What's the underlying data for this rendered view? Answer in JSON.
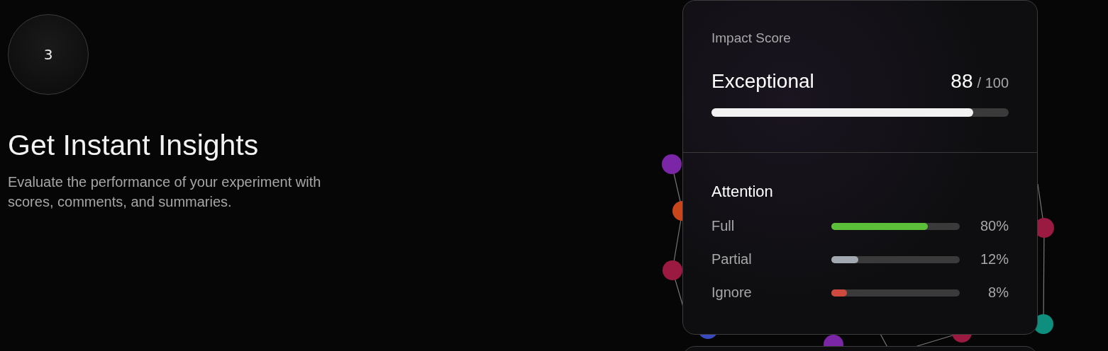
{
  "step": {
    "number": "3"
  },
  "heading": "Get Instant Insights",
  "description": "Evaluate the performance of your experiment with scores, comments, and summaries.",
  "score_card": {
    "label": "Impact Score",
    "rating": "Exceptional",
    "score": "88",
    "max": "/ 100",
    "level": 0.88
  },
  "attention": {
    "title": "Attention",
    "rows": [
      {
        "label": "Full",
        "level": 0.75,
        "color": "#5cbf3a",
        "reading": "80%"
      },
      {
        "label": "Partial",
        "level": 0.21,
        "color": "#a3a9b1",
        "reading": "12%"
      },
      {
        "label": "Ignore",
        "level": 0.12,
        "color": "#cf4a3e",
        "reading": "8%"
      }
    ]
  }
}
